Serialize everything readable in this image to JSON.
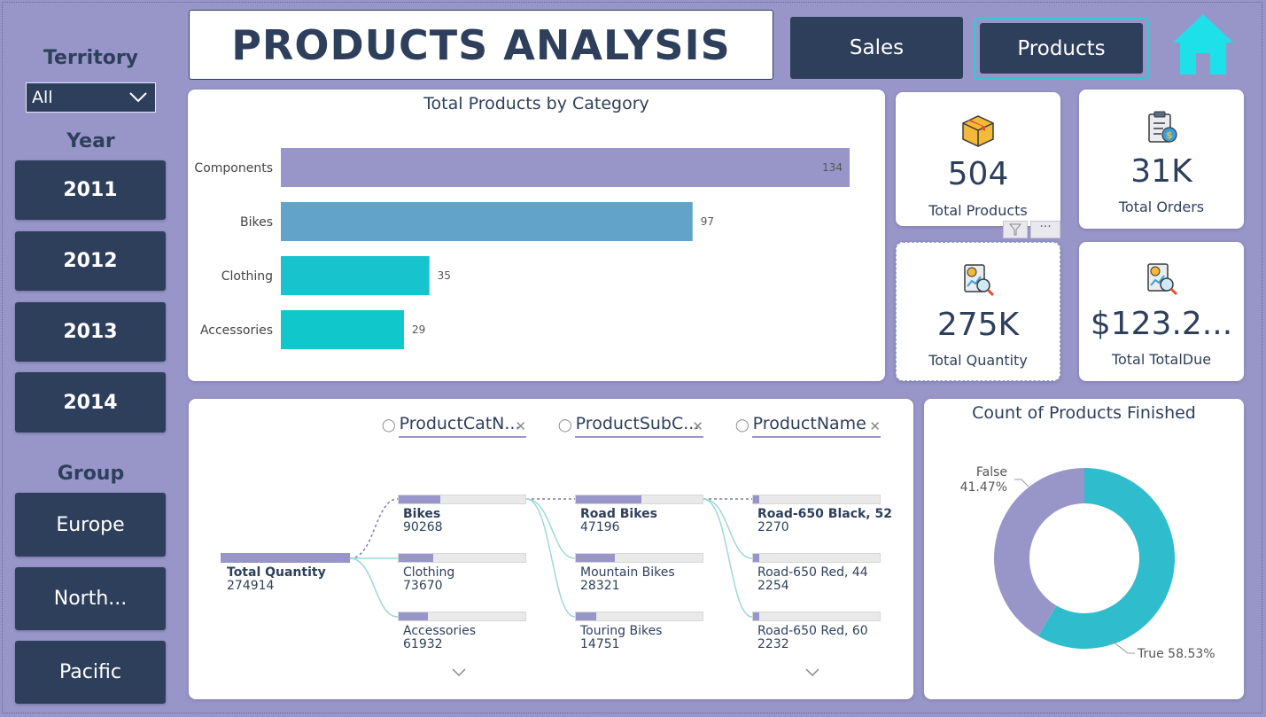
{
  "header": {
    "title": "PRODUCTS ANALYSIS",
    "sales_button": "Sales",
    "products_button": "Products",
    "home_icon": "home-icon",
    "home_color": "#1ee0e8"
  },
  "filters": {
    "territory_label": "Territory",
    "territory_value": "All",
    "year_label": "Year",
    "years": [
      "2011",
      "2012",
      "2013",
      "2014"
    ],
    "group_label": "Group",
    "groups": [
      "Europe",
      "North...",
      "Pacific"
    ]
  },
  "kpis": {
    "total_products": {
      "value": "504",
      "label": "Total Products",
      "icon": "box-icon"
    },
    "total_orders": {
      "value": "31K",
      "label": "Total Orders",
      "icon": "clipboard-dollar-icon"
    },
    "total_quantity": {
      "value": "275K",
      "label": "Total Quantity",
      "icon": "report-search-icon"
    },
    "total_due": {
      "value": "$123.2...",
      "label": "Total TotalDue",
      "icon": "report-search-icon"
    }
  },
  "decomposition": {
    "headers": [
      "ProductCatN...",
      "ProductSubC...",
      "ProductName"
    ],
    "root": {
      "label": "Total Quantity",
      "value": "274914"
    },
    "level1": [
      {
        "label": "Bikes",
        "value": "90268",
        "fraction": 0.33
      },
      {
        "label": "Clothing",
        "value": "73670",
        "fraction": 0.27
      },
      {
        "label": "Accessories",
        "value": "61932",
        "fraction": 0.23
      }
    ],
    "level2": [
      {
        "label": "Road Bikes",
        "value": "47196",
        "fraction": 0.52
      },
      {
        "label": "Mountain Bikes",
        "value": "28321",
        "fraction": 0.31
      },
      {
        "label": "Touring Bikes",
        "value": "14751",
        "fraction": 0.16
      }
    ],
    "level3": [
      {
        "label": "Road-650 Black, 52",
        "value": "2270",
        "fraction": 0.05
      },
      {
        "label": "Road-650 Red, 44",
        "value": "2254",
        "fraction": 0.05
      },
      {
        "label": "Road-650 Red, 60",
        "value": "2232",
        "fraction": 0.05
      }
    ]
  },
  "chart_data": [
    {
      "type": "bar",
      "orientation": "horizontal",
      "title": "Total Products by Category",
      "categories": [
        "Components",
        "Bikes",
        "Clothing",
        "Accessories"
      ],
      "values": [
        134,
        97,
        35,
        29
      ],
      "colors": [
        "#9896c9",
        "#62a4c9",
        "#17c3cd",
        "#10c7cc"
      ],
      "xlim": [
        0,
        134
      ],
      "xlabel": "",
      "ylabel": "",
      "grid": false
    },
    {
      "type": "pie",
      "donut": true,
      "title": "Count of Products Finished",
      "series": [
        {
          "name": "False",
          "value": 41.47,
          "label": "False 41.47%",
          "color": "#9896c9"
        },
        {
          "name": "True",
          "value": 58.53,
          "label": "True 58.53%",
          "color": "#2fbccc"
        }
      ]
    }
  ]
}
